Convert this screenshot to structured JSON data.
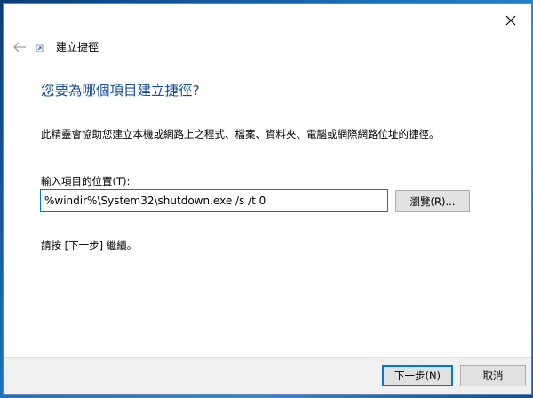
{
  "window": {
    "title": "建立捷徑",
    "close_icon": "close-icon",
    "back_icon": "back-arrow-icon",
    "shortcut_icon": "shortcut-icon"
  },
  "content": {
    "heading": "您要為哪個項目建立捷徑?",
    "description": "此精靈會協助您建立本機或網路上之程式、檔案、資料夾、電腦或網際網路位址的捷徑。",
    "location_label": "輸入項目的位置(T):",
    "location_value": "%windir%\\System32\\shutdown.exe /s /t 0",
    "browse_label": "瀏覽(R)...",
    "hint": "請按 [下一步] 繼續。"
  },
  "footer": {
    "next_label": "下一步(N)",
    "cancel_label": "取消"
  },
  "colors": {
    "heading": "#1a4f97",
    "accent": "#0078d7",
    "footer_bg": "#f0f0f0",
    "button_bg": "#e1e1e1"
  }
}
